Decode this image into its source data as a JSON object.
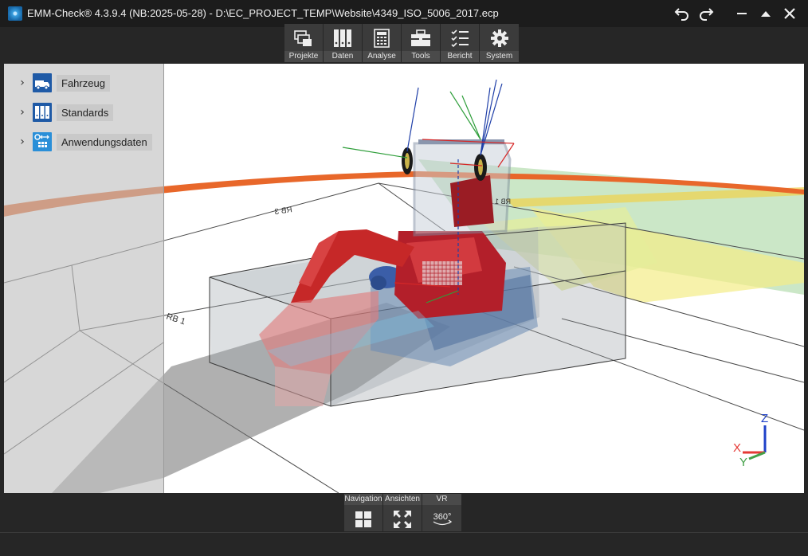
{
  "titlebar": {
    "title": "EMM-Check® 4.3.9.4 (NB:2025-05-28)  - D:\\EC_PROJECT_TEMP\\Website\\4349_ISO_5006_2017.ecp",
    "app_icon": "emm-check-logo-icon",
    "controls": [
      "undo-icon",
      "redo-icon",
      "minimize-icon",
      "maximize-icon",
      "close-icon"
    ]
  },
  "toolbar": {
    "items": [
      {
        "label": "Projekte",
        "icon": "projects-icon"
      },
      {
        "label": "Daten",
        "icon": "binders-icon"
      },
      {
        "label": "Analyse",
        "icon": "calculator-icon"
      },
      {
        "label": "Tools",
        "icon": "toolbox-icon"
      },
      {
        "label": "Bericht",
        "icon": "checklist-icon"
      },
      {
        "label": "System",
        "icon": "gear-icon"
      }
    ]
  },
  "tree": {
    "items": [
      {
        "label": "Fahrzeug",
        "icon": "vehicle-icon"
      },
      {
        "label": "Standards",
        "icon": "standards-icon"
      },
      {
        "label": "Anwendungsdaten",
        "icon": "application-data-icon"
      }
    ]
  },
  "scene": {
    "labels": {
      "rb1": "RB 1",
      "rb3": "RB 3",
      "rb1_far": "RB 1"
    }
  },
  "gizmo": {
    "x": "X",
    "y": "Y",
    "z": "Z"
  },
  "viewbar": {
    "groups": [
      {
        "label": "Navigation",
        "icon": "grid-icon"
      },
      {
        "label": "Ansichten",
        "icon": "fullscreen-icon"
      },
      {
        "label": "VR",
        "icon": "vr-360-icon",
        "text": "360°"
      }
    ]
  },
  "colors": {
    "titlebar": "#1c1c1c",
    "toolbar": "#3b3b3b",
    "machine": "#c62828",
    "arc_orange": "#e8672a",
    "visibility_green": "#a8d8a0",
    "visibility_yellow": "#f2ea7a",
    "axis_x": "#e53935",
    "axis_y": "#43a047",
    "axis_z": "#1e40c8"
  }
}
